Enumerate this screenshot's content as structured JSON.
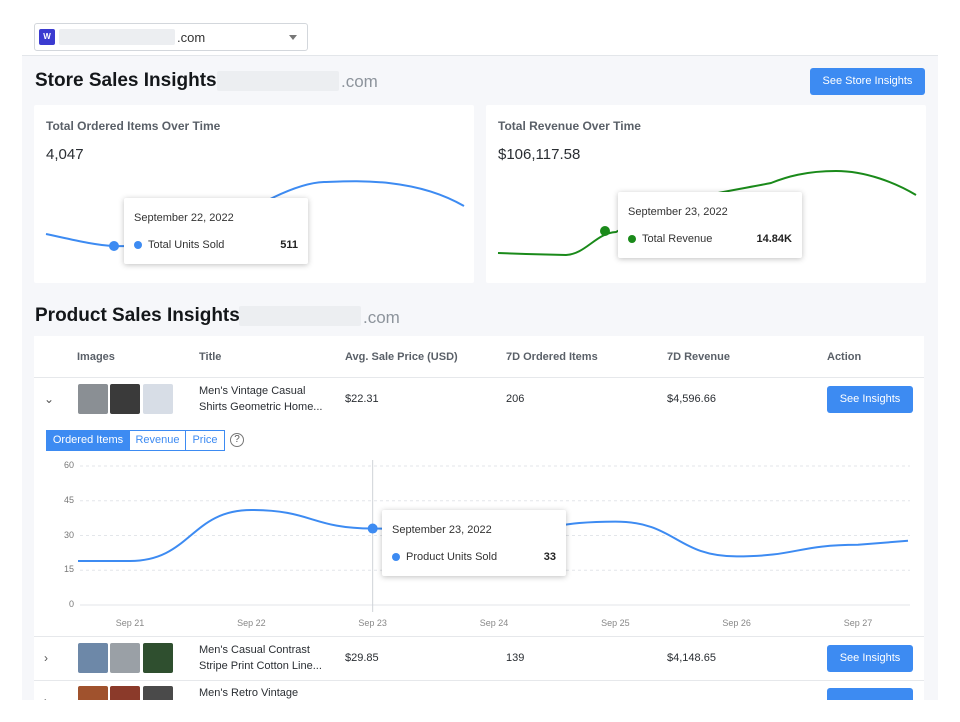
{
  "site_select": {
    "tld": ".com",
    "logo_text": "W"
  },
  "store": {
    "title": "Store Sales Insights:",
    "tld": ".com",
    "button": "See Store Insights",
    "items_card": {
      "title": "Total Ordered Items Over Time",
      "value": "4,047",
      "tooltip_date": "September 22, 2022",
      "tooltip_label": "Total Units Sold",
      "tooltip_value": "511",
      "color": "#3d8bf2"
    },
    "revenue_card": {
      "title": "Total Revenue Over Time",
      "value": "$106,117.58",
      "tooltip_date": "September 23, 2022",
      "tooltip_label": "Total Revenue",
      "tooltip_value": "14.84K",
      "color": "#1a8a1a"
    }
  },
  "product": {
    "title": "Product Sales Insights:",
    "tld": ".com",
    "columns": [
      "Images",
      "Title",
      "Avg. Sale Price (USD)",
      "7D Ordered Items",
      "7D Revenue",
      "Action"
    ],
    "rows": [
      {
        "title_1": "Men's Vintage Casual",
        "title_2": "Shirts Geometric Home...",
        "price": "$22.31",
        "items": "206",
        "revenue": "$4,596.66",
        "action": "See Insights"
      },
      {
        "title_1": "Men's Casual Contrast",
        "title_2": "Stripe Print Cotton Line...",
        "price": "$29.85",
        "items": "139",
        "revenue": "$4,148.65",
        "action": "See Insights"
      },
      {
        "title_1": "Men's Retro Vintage",
        "title_2": "",
        "price": "",
        "items": "",
        "revenue": "",
        "action": ""
      }
    ],
    "tabs": [
      "Ordered Items",
      "Revenue",
      "Price"
    ],
    "help_glyph": "?",
    "chart_tooltip": {
      "date": "September 23, 2022",
      "label": "Product Units Sold",
      "value": "33"
    }
  },
  "chart_data": [
    {
      "type": "line",
      "title": "Total Ordered Items Over Time",
      "series": [
        {
          "name": "Total Units Sold",
          "values": [
            null,
            511,
            null,
            null
          ]
        }
      ],
      "annotations": [
        "September 22, 2022: 511"
      ]
    },
    {
      "type": "line",
      "title": "Total Revenue Over Time",
      "series": [
        {
          "name": "Total Revenue",
          "values": [
            null,
            14840,
            null,
            null
          ]
        }
      ],
      "annotations": [
        "September 23, 2022: 14.84K"
      ]
    },
    {
      "type": "line",
      "x": [
        "Sep 21",
        "Sep 22",
        "Sep 23",
        "Sep 24",
        "Sep 25",
        "Sep 26",
        "Sep 27"
      ],
      "series": [
        {
          "name": "Product Units Sold",
          "values": [
            19,
            41,
            33,
            32,
            36,
            21,
            26
          ],
          "color": "#3d8bf2"
        }
      ],
      "ylim": [
        0,
        60
      ],
      "yticks": [
        0,
        15,
        30,
        45,
        60
      ],
      "grid": true
    }
  ]
}
